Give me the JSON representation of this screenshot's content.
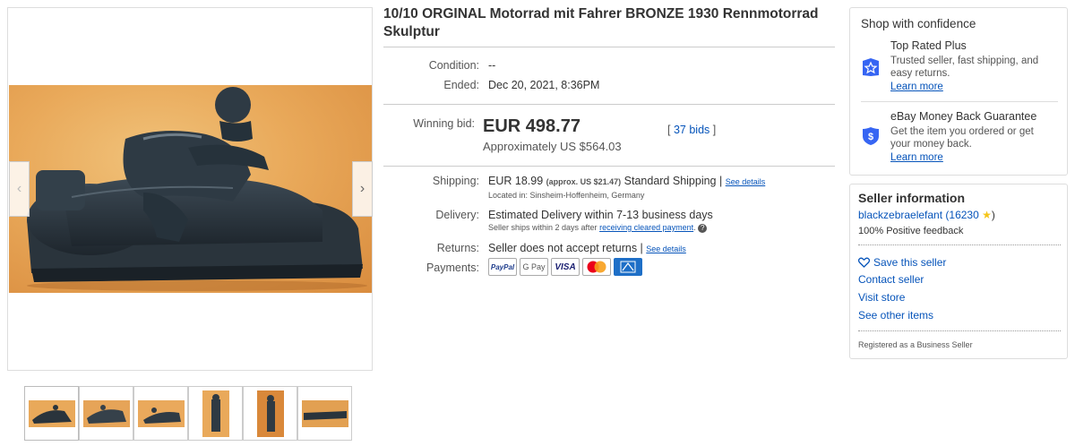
{
  "listing": {
    "title": "10/10 ORGINAL Motorrad mit Fahrer BRONZE 1930 Rennmotorrad Skulptur",
    "condition_label": "Condition:",
    "condition_value": "--",
    "ended_label": "Ended:",
    "ended_value": "Dec 20, 2021, 8:36PM",
    "winning_bid_label": "Winning bid:",
    "winning_bid_value": "EUR 498.77",
    "approx_value": "Approximately US $564.03",
    "bids_open": "[",
    "bids_link": "37 bids",
    "bids_close": "]",
    "shipping_label": "Shipping:",
    "shipping_price": "EUR 18.99",
    "shipping_approx": "(approx. US $21.47)",
    "shipping_service": "Standard Shipping |",
    "shipping_details_link": "See details",
    "located_in": "Located in:  Sinsheim-Hoffenheim, Germany",
    "delivery_label": "Delivery:",
    "delivery_value": "Estimated Delivery within 7-13 business days",
    "delivery_note": "Seller ships within 2 days after",
    "delivery_note_link": "receiving cleared payment",
    "delivery_note_end": ".",
    "returns_label": "Returns:",
    "returns_value": "Seller does not accept returns |",
    "returns_details_link": "See details",
    "payments_label": "Payments:",
    "payments": [
      "PayPal",
      "G Pay",
      "VISA",
      "",
      ""
    ]
  },
  "confidence": {
    "heading": "Shop with confidence",
    "items": [
      {
        "title": "Top Rated Plus",
        "text": "Trusted seller, fast shipping, and easy returns.",
        "link": "Learn more",
        "icon": "top-rated-star-icon"
      },
      {
        "title": "eBay Money Back Guarantee",
        "text": "Get the item you ordered or get your money back.",
        "link": "Learn more",
        "icon": "money-back-shield-icon"
      }
    ]
  },
  "seller": {
    "heading": "Seller information",
    "name": "blackzebraelefant",
    "score_open": "(16230",
    "score_close": ")",
    "feedback": "100% Positive feedback",
    "save": "Save this seller",
    "contact": "Contact seller",
    "store": "Visit store",
    "other": "See other items",
    "registered": "Registered as a Business Seller"
  },
  "gallery": {
    "prev_arrow": "‹",
    "next_arrow": "›",
    "thumb_count": 6
  },
  "colors": {
    "link": "#0654ba",
    "badge_blue": "#3665f3",
    "photo_bg": "#e9a95a"
  }
}
